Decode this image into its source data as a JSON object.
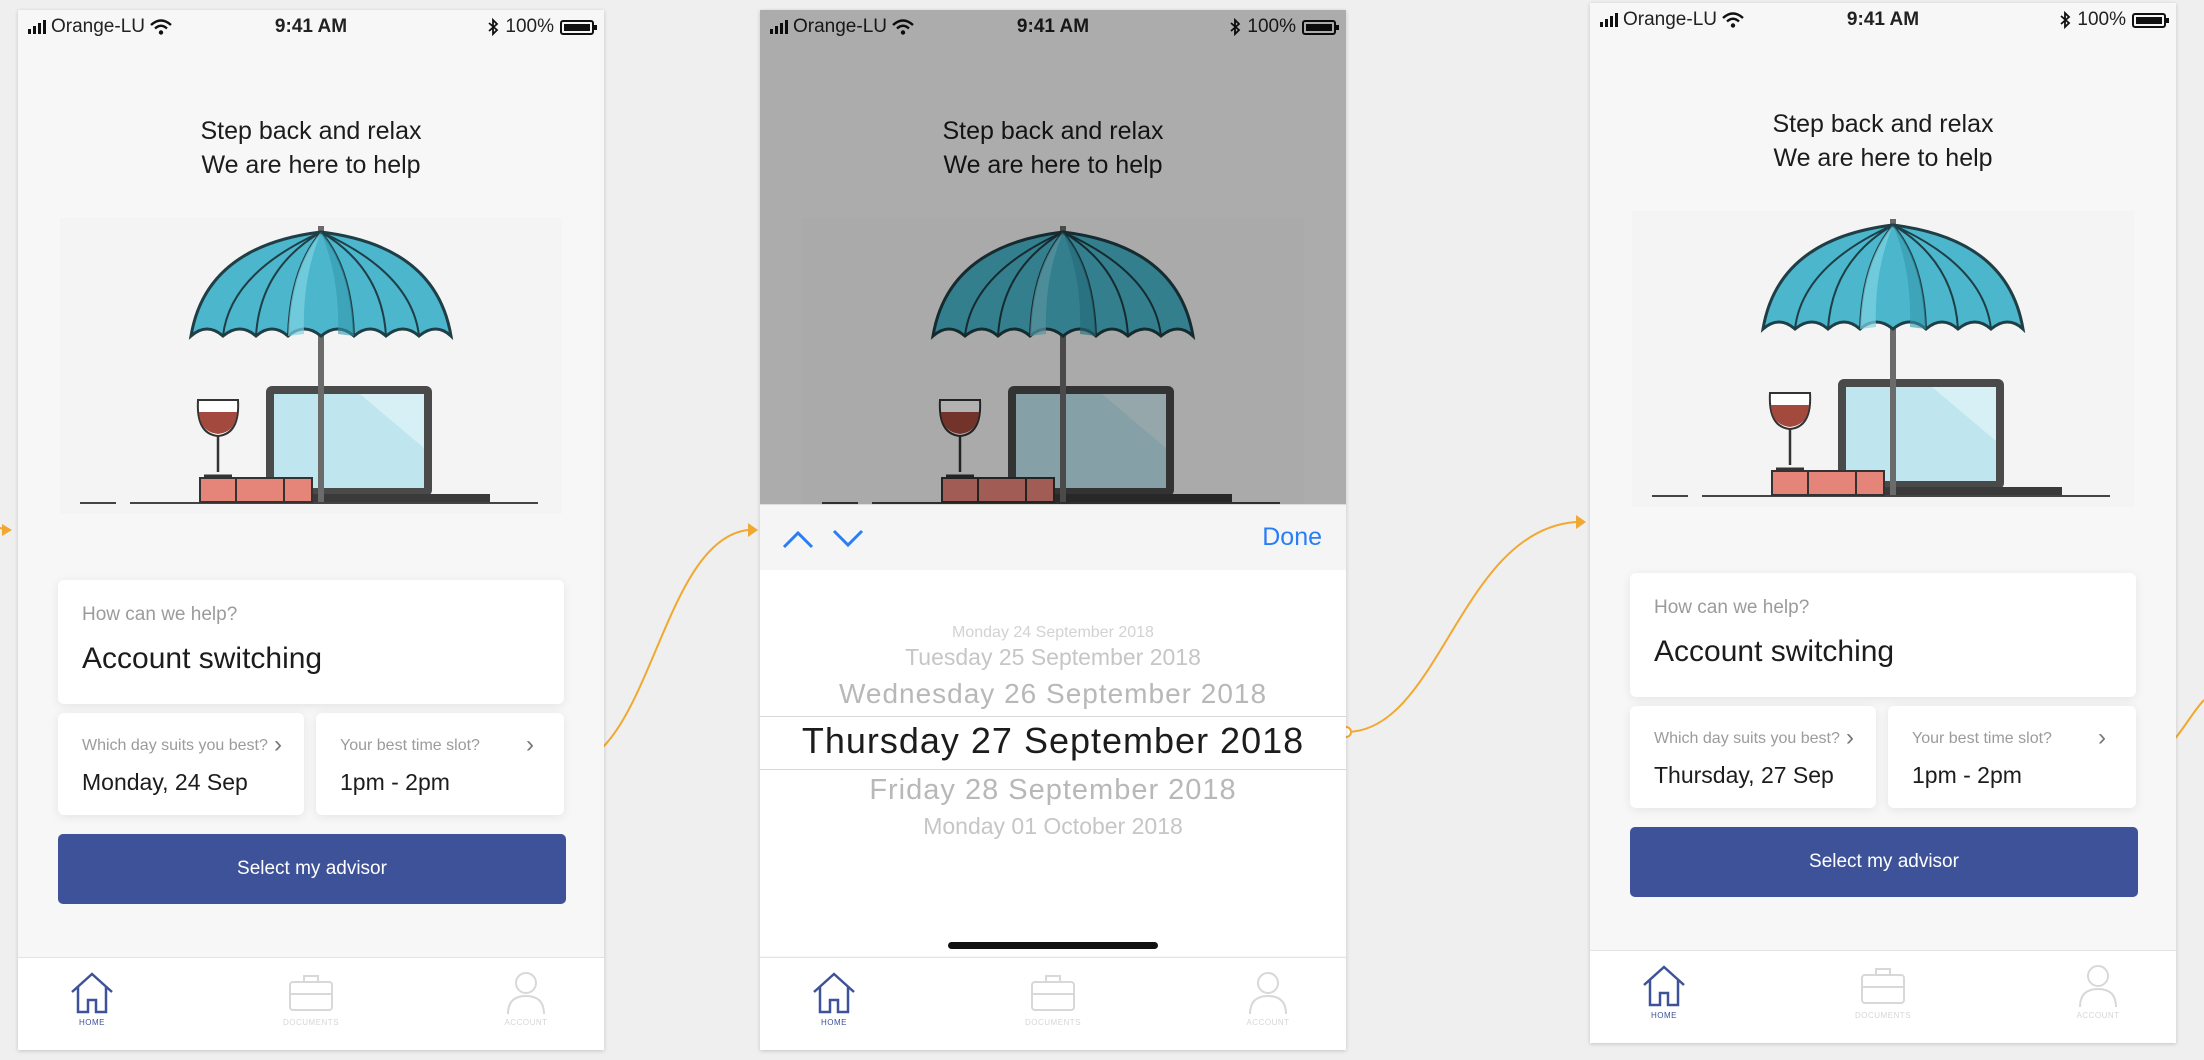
{
  "status_bar": {
    "carrier": "Orange-LU",
    "time": "9:41 AM",
    "battery": "100%"
  },
  "tagline": {
    "line1": "Step back and relax",
    "line2": "We are here to help"
  },
  "form": {
    "help_placeholder": "How can we help?",
    "help_value": "Account switching",
    "day_placeholder": "Which day suits you best?",
    "time_placeholder": "Your best time slot?",
    "time_value": "1pm - 2pm"
  },
  "screens": [
    {
      "day_value": "Monday, 24 Sep"
    },
    {
      "day_value": "Monday, 24 Sep"
    },
    {
      "day_value": "Thursday, 27 Sep"
    }
  ],
  "advisor_button": "Select my advisor",
  "tabs": {
    "home": "HOME",
    "documents": "DOCUMENTS",
    "account": "ACCOUNT"
  },
  "picker": {
    "done_label": "Done",
    "rows": [
      "Monday 24 September 2018",
      "Tuesday 25 September 2018",
      "Wednesday 26 September 2018",
      "Thursday 27 September 2018",
      "Friday 28  September 2018",
      "Monday 01 October 2018"
    ],
    "selected": "Thursday 27 September 2018"
  },
  "colors": {
    "accent": "#3d5299",
    "ios_blue": "#2a7ef5",
    "umbrella": "#4bb6cc",
    "flow_line": "#f0a830"
  },
  "icons": [
    "signal-icon",
    "wifi-icon",
    "bluetooth-icon",
    "battery-icon",
    "chevron-right-icon",
    "home-icon",
    "briefcase-icon",
    "user-icon",
    "chevron-up-icon",
    "chevron-down-icon",
    "umbrella-illustration"
  ]
}
